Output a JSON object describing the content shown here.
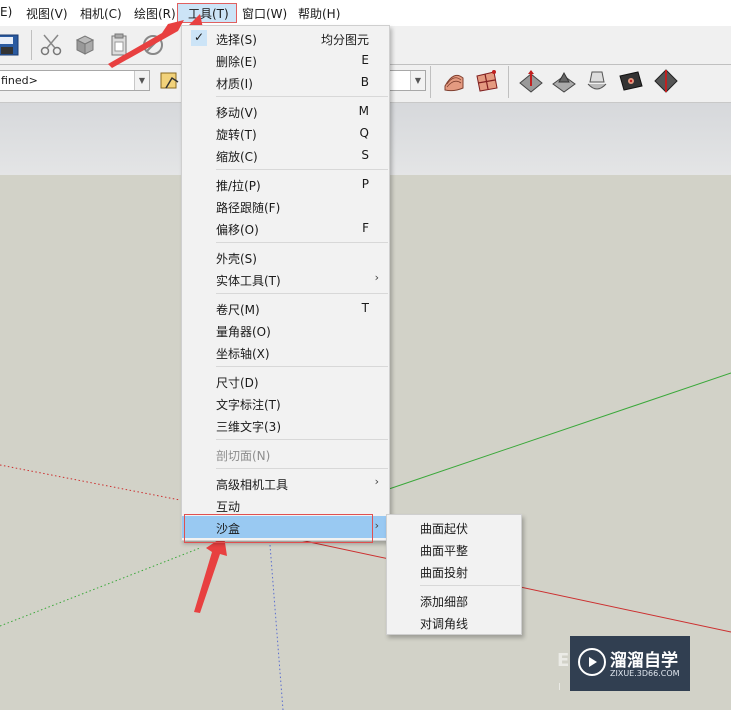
{
  "menubar": {
    "items": [
      "E)",
      "视图(V)",
      "相机(C)",
      "绘图(R)",
      "工具(T)",
      "窗口(W)",
      "帮助(H)"
    ]
  },
  "toolbar": {
    "layer_value": "fined>"
  },
  "tools_menu": {
    "items": [
      {
        "label": "选择(S)",
        "accel": "均分图元",
        "checked": true
      },
      {
        "label": "删除(E)",
        "accel": "E"
      },
      {
        "label": "材质(I)",
        "accel": "B"
      },
      {
        "label": "移动(V)",
        "accel": "M"
      },
      {
        "label": "旋转(T)",
        "accel": "Q"
      },
      {
        "label": "缩放(C)",
        "accel": "S"
      },
      {
        "label": "推/拉(P)",
        "accel": "P"
      },
      {
        "label": "路径跟随(F)",
        "accel": ""
      },
      {
        "label": "偏移(O)",
        "accel": "F"
      },
      {
        "label": "外壳(S)",
        "accel": ""
      },
      {
        "label": "实体工具(T)",
        "accel": "",
        "submenu": true
      },
      {
        "label": "卷尺(M)",
        "accel": "T"
      },
      {
        "label": "量角器(O)",
        "accel": ""
      },
      {
        "label": "坐标轴(X)",
        "accel": ""
      },
      {
        "label": "尺寸(D)",
        "accel": ""
      },
      {
        "label": "文字标注(T)",
        "accel": ""
      },
      {
        "label": "三维文字(3)",
        "accel": ""
      },
      {
        "label": "剖切面(N)",
        "accel": "",
        "disabled": true
      },
      {
        "label": "高级相机工具",
        "accel": "",
        "submenu": true
      },
      {
        "label": "互动",
        "accel": ""
      },
      {
        "label": "沙盒",
        "accel": "",
        "submenu": true,
        "highlighted": true
      }
    ],
    "submenu_arrow": "›",
    "check_mark": "✓"
  },
  "sandbox_submenu": {
    "items": [
      "曲面起伏",
      "曲面平整",
      "曲面投射",
      "添加细部",
      "对调角线"
    ]
  },
  "watermark": {
    "title": "溜溜自学",
    "url": "ZIXUE.3D66.COM",
    "ghost": "E",
    "ghost_small": "I"
  },
  "colors": {
    "highlight": "#99c9f2",
    "annotation_red": "#e84040",
    "green_axis": "#3aa83a",
    "red_axis": "#cc3030",
    "blue_axis": "#5a6ed0"
  }
}
